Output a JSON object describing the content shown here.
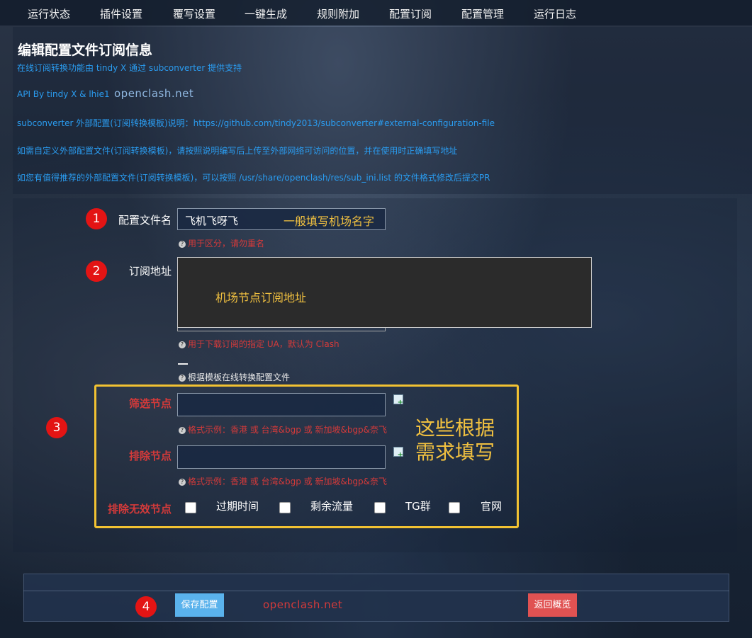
{
  "nav": {
    "items": [
      "运行状态",
      "插件设置",
      "覆写设置",
      "一键生成",
      "规则附加",
      "配置订阅",
      "配置管理",
      "运行日志"
    ]
  },
  "page": {
    "title": "编辑配置文件订阅信息",
    "info_lines": [
      "在线订阅转换功能由 tindy X 通过 subconverter 提供支持",
      "API By tindy X & lhie1",
      "subconverter 外部配置(订阅转换模板)说明：https://github.com/tindy2013/subconverter#external-configuration-file",
      "如需自定义外部配置文件(订阅转换模板)，请按照说明编写后上传至外部网络可访问的位置，并在使用时正确填写地址",
      "如您有值得推荐的外部配置文件(订阅转换模板)，可以按照 /usr/share/openclash/res/sub_ini.list 的文件格式修改后提交PR"
    ],
    "watermark": "openclash.net"
  },
  "form": {
    "config_name": {
      "label": "配置文件名",
      "value": "飞机飞呀飞",
      "annotation": "一般填写机场名字",
      "hint": "用于区分，请勿重名"
    },
    "subscribe_url": {
      "label": "订阅地址",
      "annotation": "机场节点订阅地址",
      "hint": "用于下载订阅的指定 UA，默认为 Clash"
    },
    "template_hint": "根据模板在线转换配置文件",
    "filter_nodes": {
      "label": "筛选节点",
      "value": "",
      "hint": "格式示例：香港 或 台湾&bgp 或 新加坡&bgp&奈飞"
    },
    "exclude_nodes": {
      "label": "排除节点",
      "value": "",
      "hint": "格式示例：香港 或 台湾&bgp 或 新加坡&bgp&奈飞"
    },
    "exclude_invalid": {
      "label": "排除无效节点",
      "options": [
        "过期时间",
        "剩余流量",
        "TG群",
        "官网"
      ]
    },
    "box_annotation_line1": "这些根据",
    "box_annotation_line2": "需求填写"
  },
  "badges": [
    "1",
    "2",
    "3",
    "4"
  ],
  "footer": {
    "save_label": "保存配置",
    "back_label": "返回概览",
    "watermark": "openclash.net"
  },
  "colors": {
    "info_blue": "#2a9cf0",
    "hint_red": "#d43a3a",
    "annotation_yellow": "#f0c040",
    "save_button": "#5ab2ec",
    "back_button": "#e05252",
    "badge_red": "#e31414"
  }
}
